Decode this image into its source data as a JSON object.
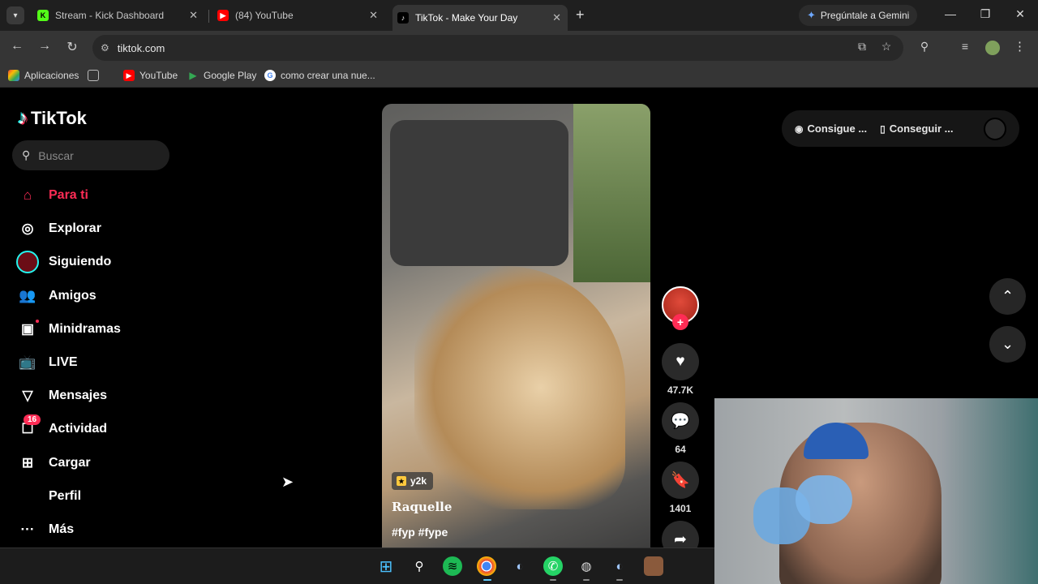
{
  "browser": {
    "tabs": [
      {
        "title": "Stream - Kick Dashboard",
        "icon": "kick-icon",
        "active": false
      },
      {
        "title": "(84) YouTube",
        "icon": "youtube-icon",
        "active": false
      },
      {
        "title": "TikTok - Make Your Day",
        "icon": "tiktok-icon",
        "active": true
      }
    ],
    "new_tab": "+",
    "gemini_label": "Pregúntale a Gemini",
    "url": "tiktok.com",
    "bookmarks": [
      {
        "label": "Aplicaciones",
        "icon": "apps-grid-icon"
      },
      {
        "label": "YouTube",
        "icon": "youtube-icon"
      },
      {
        "label": "Google Play",
        "icon": "google-play-icon"
      },
      {
        "label": "como crear una nue...",
        "icon": "google-icon"
      }
    ]
  },
  "tiktok": {
    "logo_text": "TikTok",
    "search_placeholder": "Buscar",
    "nav": [
      {
        "label": "Para ti",
        "icon": "home-icon",
        "active": true
      },
      {
        "label": "Explorar",
        "icon": "compass-icon"
      },
      {
        "label": "Siguiendo",
        "icon": "following-avatar-icon"
      },
      {
        "label": "Amigos",
        "icon": "friends-icon"
      },
      {
        "label": "Minidramas",
        "icon": "film-icon"
      },
      {
        "label": "LIVE",
        "icon": "live-tv-icon"
      },
      {
        "label": "Mensajes",
        "icon": "send-icon"
      },
      {
        "label": "Actividad",
        "icon": "activity-icon",
        "badge": "16"
      },
      {
        "label": "Cargar",
        "icon": "plus-square-icon"
      },
      {
        "label": "Perfil",
        "icon": ""
      },
      {
        "label": "Más",
        "icon": "more-dots-icon"
      }
    ],
    "video": {
      "tag": "y2k",
      "author": "Raquelle",
      "caption": "#fyp #fype"
    },
    "actions": {
      "likes": "47.7K",
      "comments": "64",
      "saves": "1401"
    },
    "get_buttons": [
      {
        "label": "Consigue ...",
        "icon": "app-icon"
      },
      {
        "label": "Conseguir ...",
        "icon": "phone-icon"
      }
    ]
  },
  "colors": {
    "accent": "#fe2c55",
    "tiktok_cyan": "#25f4ee",
    "chrome_dark": "#1f1f1f",
    "chrome_mid": "#353535"
  }
}
